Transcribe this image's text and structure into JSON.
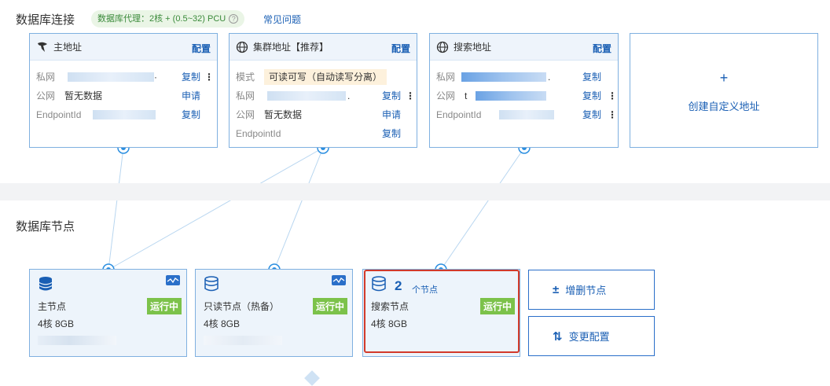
{
  "connection": {
    "title": "数据库连接",
    "proxy_badge": "数据库代理：2核 + (0.5~32) PCU",
    "faq_link": "常见问题"
  },
  "addresses": {
    "primary": {
      "title": "主地址",
      "config": "配置",
      "rows": [
        {
          "label": "私网",
          "value": "·",
          "action": "复制"
        },
        {
          "label": "公网",
          "value": "暂无数据",
          "action": "申请"
        },
        {
          "label": "EndpointId",
          "value": "",
          "action": "复制"
        }
      ]
    },
    "cluster": {
      "title": "集群地址【推荐】",
      "config": "配置",
      "rows": [
        {
          "label": "模式",
          "value": "可读可写（自动读写分离）",
          "action": ""
        },
        {
          "label": "私网",
          "value": ".",
          "action": "复制"
        },
        {
          "label": "公网",
          "value": "暂无数据",
          "action": "申请"
        },
        {
          "label": "EndpointId",
          "value": "",
          "action": "复制"
        }
      ]
    },
    "search": {
      "title": "搜索地址",
      "config": "配置",
      "rows": [
        {
          "label": "私网",
          "value": ".",
          "action": "复制"
        },
        {
          "label": "公网",
          "value": "t",
          "action": "复制"
        },
        {
          "label": "EndpointId",
          "value": "",
          "action": "复制"
        }
      ]
    },
    "custom": {
      "label": "创建自定义地址",
      "plus": "+"
    }
  },
  "nodes_section": {
    "title": "数据库节点",
    "nodes": [
      {
        "name": "主节点",
        "spec": "4核 8GB",
        "status": "运行中"
      },
      {
        "name": "只读节点（热备）",
        "spec": "4核 8GB",
        "status": "运行中"
      },
      {
        "name": "搜索节点",
        "spec": "4核 8GB",
        "status": "运行中",
        "count": "2",
        "count_label": "个节点"
      }
    ],
    "actions": {
      "add_remove": {
        "icon": "±",
        "label": "增删节点"
      },
      "change_config": {
        "icon": "⇅",
        "label": "变更配置"
      }
    }
  },
  "colors": {
    "accent": "#1a5fb4",
    "border": "#7fb0e0",
    "running": "#7cc24a",
    "highlight": "#d23a2a"
  }
}
